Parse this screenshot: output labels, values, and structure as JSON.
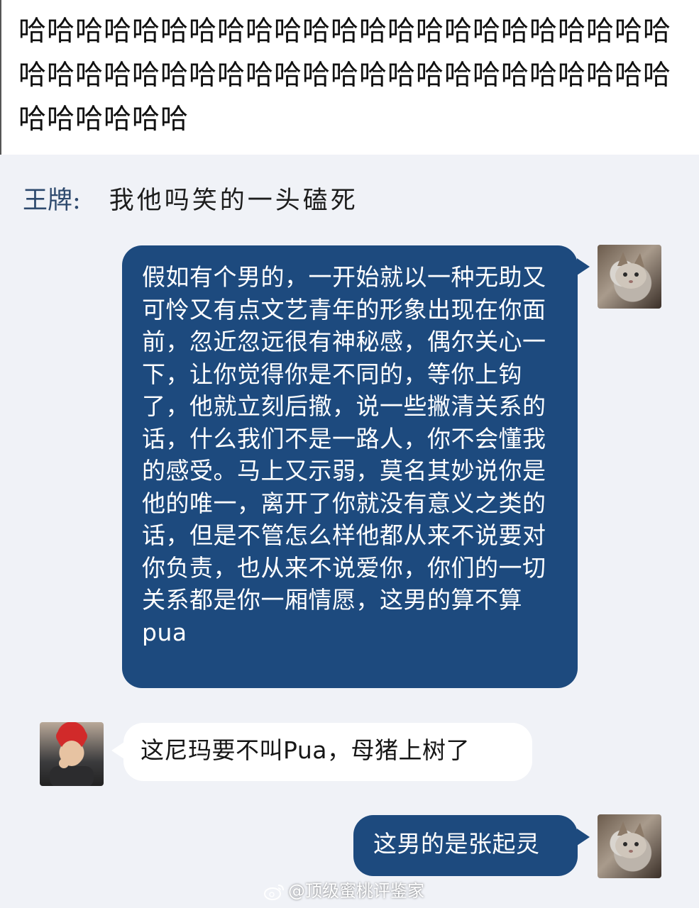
{
  "top_note": {
    "text": "哈哈哈哈哈哈哈哈哈哈哈哈哈哈哈哈哈哈哈哈哈哈哈哈哈哈哈哈哈哈哈哈哈哈哈哈哈哈哈哈哈哈哈哈哈哈哈哈哈哈哈哈"
  },
  "caption": {
    "name": "王牌:",
    "message": "我他吗笑的一头磕死"
  },
  "messages": [
    {
      "side": "right",
      "avatar": "cat-avatar",
      "text": "假如有个男的，一开始就以一种无助又可怜又有点文艺青年的形象出现在你面前，忽近忽远很有神秘感，偶尔关心一下，让你觉得你是不同的，等你上钩了，他就立刻后撤，说一些撇清关系的话，什么我们不是一路人，你不会懂我的感受。马上又示弱，莫名其妙说你是他的唯一，离开了你就没有意义之类的话，但是不管怎么样他都从来不说要对你负责，也从来不说爱你，你们的一切关系都是你一厢情愿，这男的算不算pua"
    },
    {
      "side": "left",
      "avatar": "person-avatar",
      "text": "这尼玛要不叫Pua，母猪上树了"
    },
    {
      "side": "right",
      "avatar": "cat-avatar",
      "text": "这男的是张起灵"
    }
  ],
  "watermark": {
    "text": "@顶级蜜桃评鉴家",
    "icon": "weibo-logo-icon"
  },
  "colors": {
    "sent_bubble": "#1d4a7e",
    "recv_bubble": "#ffffff",
    "background": "#f0f2f7",
    "caption_name": "#2e4a6e"
  }
}
